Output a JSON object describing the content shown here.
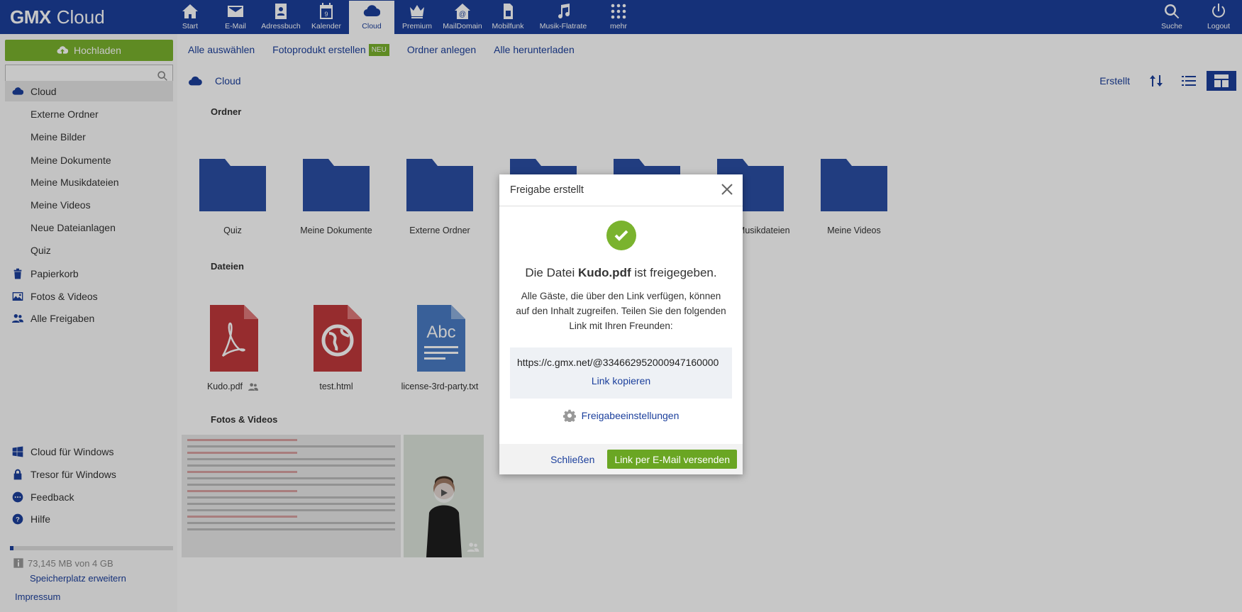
{
  "brand": {
    "bold": "GMX",
    "light": "Cloud"
  },
  "nav": [
    {
      "label": "Start",
      "icon": "home-icon"
    },
    {
      "label": "E-Mail",
      "icon": "mail-icon"
    },
    {
      "label": "Adressbuch",
      "icon": "addressbook-icon"
    },
    {
      "label": "Kalender",
      "icon": "calendar-icon"
    },
    {
      "label": "Cloud",
      "icon": "cloud-icon",
      "active": true
    },
    {
      "label": "Premium",
      "icon": "crown-icon"
    },
    {
      "label": "MailDomain",
      "icon": "maildomain-icon"
    },
    {
      "label": "Mobilfunk",
      "icon": "sim-icon"
    },
    {
      "label": "Musik-Flatrate",
      "icon": "music-icon"
    },
    {
      "label": "mehr",
      "icon": "grid-icon"
    }
  ],
  "nav_right": [
    {
      "label": "Suche",
      "icon": "search-icon"
    },
    {
      "label": "Logout",
      "icon": "power-icon"
    }
  ],
  "calendar_day": "9",
  "sidebar": {
    "upload_label": "Hochladen",
    "search_placeholder": "",
    "items": [
      {
        "label": "Cloud",
        "icon": "cloud-icon",
        "active": true
      },
      {
        "label": "Externe Ordner"
      },
      {
        "label": "Meine Bilder"
      },
      {
        "label": "Meine Dokumente"
      },
      {
        "label": "Meine Musikdateien"
      },
      {
        "label": "Meine Videos"
      },
      {
        "label": "Neue Dateianlagen"
      },
      {
        "label": "Quiz"
      },
      {
        "label": "Papierkorb",
        "icon": "trash-icon"
      },
      {
        "label": "Fotos & Videos",
        "icon": "image-icon"
      },
      {
        "label": "Alle Freigaben",
        "icon": "users-icon"
      }
    ],
    "bottom_items": [
      {
        "label": "Cloud für Windows",
        "icon": "windows-icon"
      },
      {
        "label": "Tresor für Windows",
        "icon": "lock-icon"
      },
      {
        "label": "Feedback",
        "icon": "chat-icon"
      },
      {
        "label": "Hilfe",
        "icon": "help-icon"
      }
    ],
    "quota_text": "73,145 MB von 4 GB",
    "quota_fraction": 0.02,
    "more_space": "Speicherplatz erweitern",
    "impressum": "Impressum"
  },
  "toolbar": {
    "select_all": "Alle auswählen",
    "photo_product": "Fotoprodukt erstellen",
    "new_badge": "NEU",
    "create_folder": "Ordner anlegen",
    "download_all": "Alle herunterladen"
  },
  "content": {
    "breadcrumb": "Cloud",
    "sort_label": "Erstellt",
    "folders_heading": "Ordner",
    "folders": [
      "Quiz",
      "Meine Dokumente",
      "Externe Ordner",
      "",
      "",
      "Meine Musikdateien",
      "Meine Videos"
    ],
    "files_heading": "Dateien",
    "files": [
      {
        "name": "Kudo.pdf",
        "type": "pdf",
        "shared": true
      },
      {
        "name": "test.html",
        "type": "html"
      },
      {
        "name": "license-3rd-party.txt",
        "type": "txt",
        "icon_text": "Abc"
      }
    ],
    "photos_heading": "Fotos & Videos"
  },
  "dialog": {
    "title": "Freigabe erstellt",
    "message_pre": "Die Datei",
    "message_file": "Kudo.pdf",
    "message_post": "ist freigegeben.",
    "description": "Alle Gäste, die über den Link verfügen, können auf den Inhalt zugreifen. Teilen Sie den folgenden Link mit Ihren Freunden:",
    "url": "https://c.gmx.net/@334662952000947160000",
    "copy_link": "Link kopieren",
    "share_settings": "Freigabeeinstellungen",
    "close": "Schließen",
    "send_email": "Link per E-Mail versenden"
  },
  "colors": {
    "brand": "#1b3f9c",
    "accent_green": "#7ab32e",
    "folder": "#2b4fa4",
    "pdf": "#c0393b",
    "txt": "#4a7cc4"
  }
}
